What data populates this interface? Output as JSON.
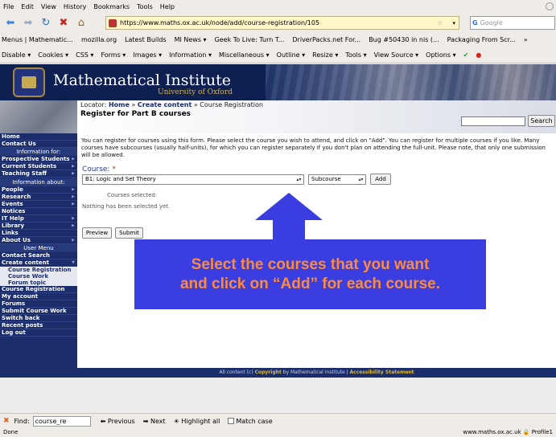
{
  "browser": {
    "menu": [
      "File",
      "Edit",
      "View",
      "History",
      "Bookmarks",
      "Tools",
      "Help"
    ],
    "url": "https://www.maths.ox.ac.uk/node/add/course-registration/105",
    "search_placeholder": "Google",
    "search_engine_letter": "G",
    "bookmarks": [
      "Menus | Mathematic...",
      "mozilla.org",
      "Latest Builds",
      "MI News ▾",
      "Geek To Live: Turn T...",
      "DriverPacks.net For...",
      "Bug #50430 in nis (...",
      "Packaging From Scr...",
      "»"
    ],
    "devtoolbar": [
      "Disable ▾",
      "Cookies ▾",
      "CSS ▾",
      "Forms ▾",
      "Images ▾",
      "Information ▾",
      "Miscellaneous ▾",
      "Outline ▾",
      "Resize ▾",
      "Tools ▾",
      "View Source ▾",
      "Options ▾"
    ]
  },
  "site": {
    "title": "Mathematical Institute",
    "subtitle": "University of Oxford",
    "locator_prefix": "Locator:",
    "locator_home": "Home",
    "locator_sep1": "»",
    "locator_create": "Create content",
    "locator_sep2": "» Course Registration",
    "page_title": "Register for Part B courses",
    "search_button": "Search"
  },
  "sidebar": {
    "home": "Home",
    "contact": "Contact Us",
    "info_for": "Information for:",
    "prospective": "Prospective Students",
    "current": "Current Students",
    "teaching": "Teaching Staff",
    "info_about": "Information about:",
    "people": "People",
    "research": "Research",
    "events": "Events",
    "notices": "Notices",
    "ithelp": "IT Help",
    "library": "Library",
    "links": "Links",
    "about": "About Us",
    "user_menu": "User Menu",
    "contact_search": "Contact Search",
    "create_content": "Create content",
    "course_registration_sub": "Course Registration",
    "course_work": "Course Work",
    "forum_topic": "Forum topic",
    "course_registration": "Course Registration",
    "my_account": "My account",
    "forums": "Forums",
    "submit_course_work": "Submit Course Work",
    "switch_back": "Switch back",
    "recent_posts": "Recent posts",
    "log_out": "Log out"
  },
  "form": {
    "intro": "You can register for courses using this form. Please select the course you wish to attend, and click on \"Add\". You can register for multiple courses if you like. Many courses have subcourses (usually half-units), for which you can register separately if you don't plan on attending the full-unit. Please note, that only one submission will be allowed.",
    "course_label": "Course:",
    "required_mark": "*",
    "course_value": "B1: Logic and Set Theory",
    "subcourse_value": "Subcourse",
    "add_button": "Add",
    "selected_heading": "Courses selected:",
    "nothing_selected": "Nothing has been selected yet.",
    "preview_button": "Preview",
    "submit_button": "Submit"
  },
  "footer": {
    "pre": "All content (c)",
    "copyright": "Copyright",
    "mid": "by Mathematical Institute |",
    "accessibility": "Accessibility Statement"
  },
  "callout": {
    "line1": "Select the courses that you want",
    "line2": "and click on “Add” for each course."
  },
  "findbar": {
    "label": "Find:",
    "value": "course_re",
    "previous": "Previous",
    "next": "Next",
    "highlight": "Highlight all",
    "match_case": "Match case"
  },
  "status": {
    "left": "Done",
    "right": "www.maths.ox.ac.uk",
    "profile": "Profile1"
  },
  "colors": {
    "site_navy": "#1b2d6b",
    "callout_bg": "#3a3ee0",
    "callout_text": "#ff8a3a",
    "arrow": "#3a3ee0"
  }
}
